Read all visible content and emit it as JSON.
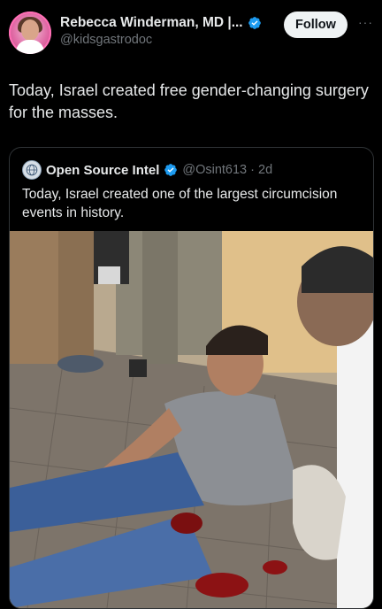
{
  "author": {
    "display_name": "Rebecca Winderman, MD |...",
    "handle": "@kidsgastrodoc"
  },
  "follow_label": "Follow",
  "more_label": "···",
  "tweet_text": "Today, Israel created free gender-changing surgery for the masses.",
  "quote": {
    "name": "Open Source Intel",
    "meta": "@Osint613 · 2d",
    "text": "Today, Israel created one of the largest circumcision events in history."
  },
  "colors": {
    "verified": "#1d9bf0",
    "background": "#000000",
    "text": "#e7e9ea",
    "muted": "#71767b"
  }
}
